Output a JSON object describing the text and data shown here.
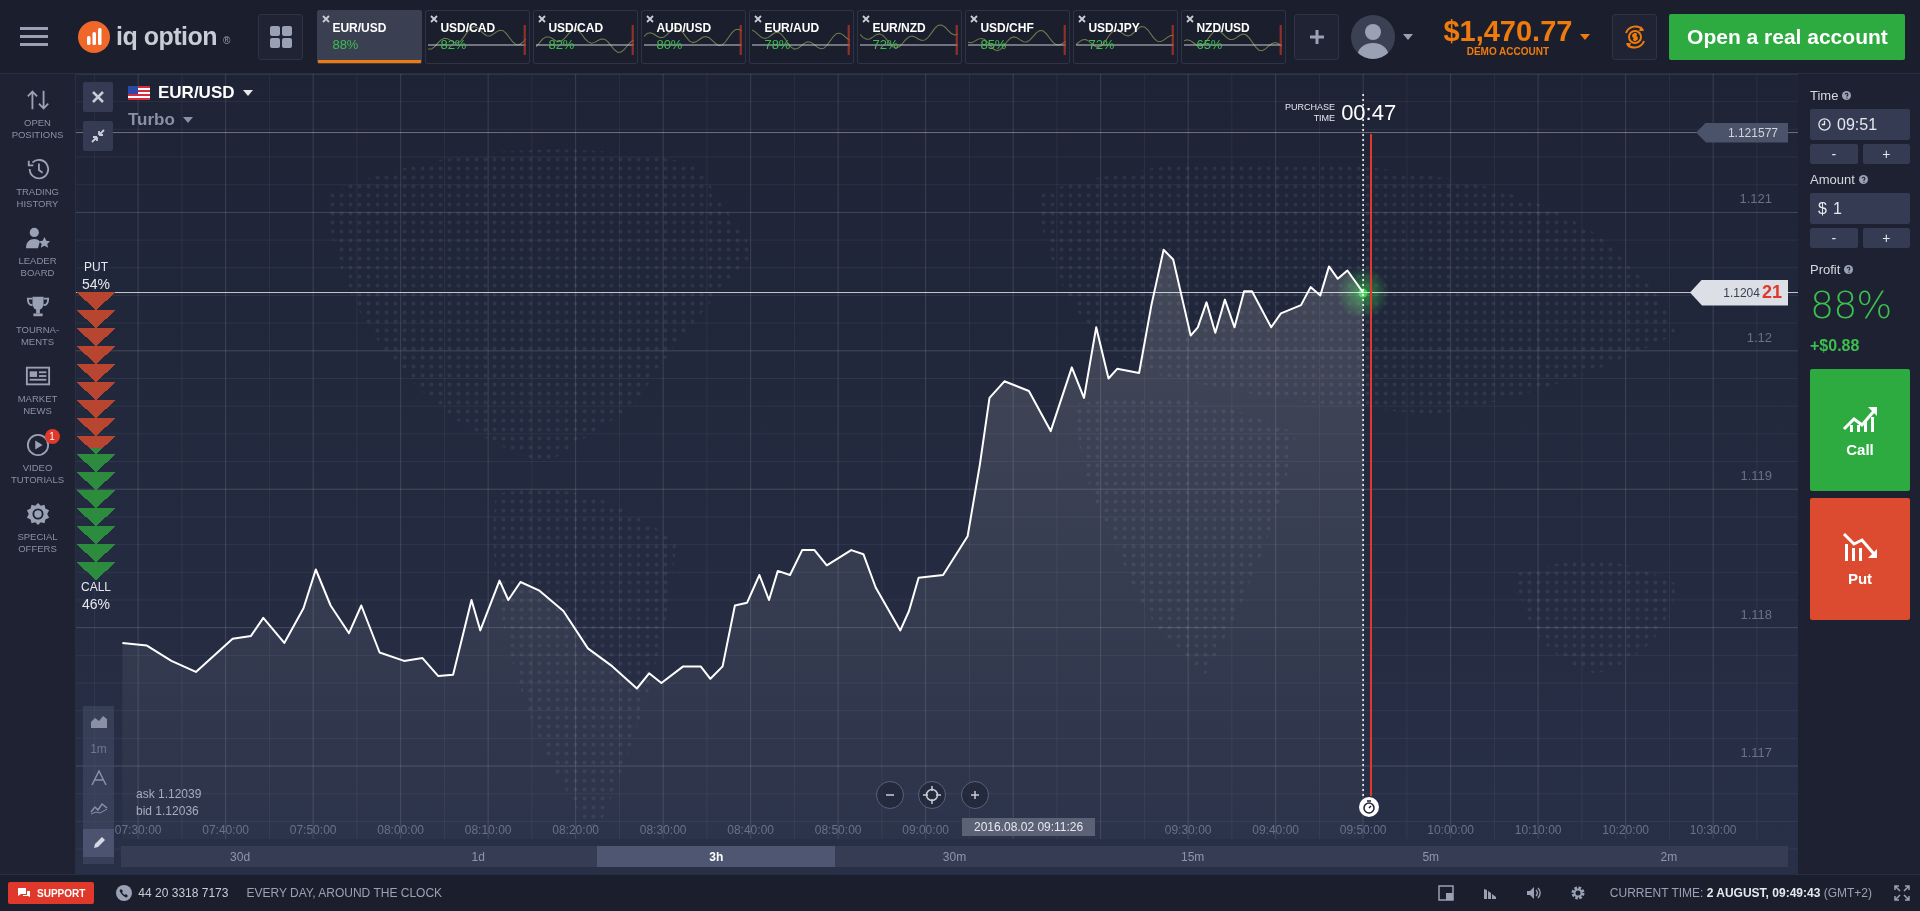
{
  "top_bar": {
    "logo_text": "iq option",
    "logo_mark": "®",
    "asset_tabs": [
      {
        "name": "EUR/USD",
        "percent": "88%",
        "selected": true
      },
      {
        "name": "USD/CAD",
        "percent": "82%",
        "selected": false
      },
      {
        "name": "USD/CAD",
        "percent": "82%",
        "selected": false
      },
      {
        "name": "AUD/USD",
        "percent": "80%",
        "selected": false
      },
      {
        "name": "EUR/AUD",
        "percent": "78%",
        "selected": false
      },
      {
        "name": "EUR/NZD",
        "percent": "72%",
        "selected": false
      },
      {
        "name": "USD/CHF",
        "percent": "85%",
        "selected": false
      },
      {
        "name": "USD/JPY",
        "percent": "72%",
        "selected": false
      },
      {
        "name": "NZD/USD",
        "percent": "65%",
        "selected": false
      }
    ],
    "balance": "$1,470.77",
    "account_type": "DEMO ACCOUNT",
    "cta": "Open a real account"
  },
  "sidebar": {
    "items": [
      {
        "kind": "positions",
        "label": "OPEN POSITIONS"
      },
      {
        "kind": "history",
        "label": "TRADING HISTORY"
      },
      {
        "kind": "leaderboard",
        "label": "LEADER BOARD"
      },
      {
        "kind": "tournaments",
        "label": "TOURNA-MENTS"
      },
      {
        "kind": "news",
        "label": "MARKET NEWS"
      },
      {
        "kind": "video",
        "label": "VIDEO TUTORIALS",
        "badge": "1"
      },
      {
        "kind": "offers",
        "label": "SPECIAL OFFERS"
      }
    ]
  },
  "chart": {
    "asset": "EUR/USD",
    "mode": "Turbo",
    "sentiment": {
      "put_label": "PUT",
      "put_percent": "54%",
      "call_label": "CALL",
      "call_percent": "46%",
      "level": 0.54
    },
    "purchase_time": {
      "label": "PURCHASE TIME",
      "value": "00:47"
    },
    "current_price": {
      "main": "1.1204",
      "last_digits": "21"
    },
    "timeframe": "1m",
    "ask": "ask 1.12039",
    "bid": "bid 1.12036",
    "cursor_time": "2016.08.02 09:11:26",
    "ranges": [
      {
        "label": "30d",
        "selected": false
      },
      {
        "label": "1d",
        "selected": false
      },
      {
        "label": "3h",
        "selected": true
      },
      {
        "label": "30m",
        "selected": false
      },
      {
        "label": "15m",
        "selected": false
      },
      {
        "label": "5m",
        "selected": false
      },
      {
        "label": "2m",
        "selected": false
      }
    ],
    "chart_data": {
      "type": "line",
      "xlim": [
        442.9,
        639.7
      ],
      "ylim": [
        1.11622,
        1.122
      ],
      "x": [
        448.2,
        451.0,
        453.8,
        456.6,
        460.8,
        462.9,
        464.3,
        466.7,
        468.9,
        470.3,
        472.0,
        474.1,
        475.5,
        477.6,
        480.4,
        482.5,
        484.3,
        486.0,
        488.1,
        489.1,
        491.3,
        492.3,
        493.7,
        495.8,
        498.6,
        501.4,
        504.2,
        507.0,
        508.4,
        509.8,
        512.3,
        514.3,
        515.4,
        516.8,
        518.2,
        519.6,
        521.0,
        522.1,
        523.1,
        524.5,
        525.9,
        527.3,
        528.7,
        531.5,
        532.9,
        534.3,
        537.1,
        538.1,
        539.2,
        542.0,
        544.8,
        546.2,
        547.3,
        549.0,
        551.8,
        554.3,
        556.7,
        558.1,
        559.5,
        560.9,
        561.9,
        564.4,
        565.8,
        567.2,
        568.3,
        570.3,
        571.1,
        572.1,
        573.1,
        574.2,
        575.3,
        576.4,
        577.3,
        579.5,
        580.6,
        582.9,
        584.0,
        585.1,
        586.1,
        587.1,
        588.2,
        590.0
      ],
      "series": [
        {
          "color": "#ffffff",
          "values": [
            1.11789,
            1.11787,
            1.11776,
            1.11768,
            1.11792,
            1.11794,
            1.11807,
            1.11789,
            1.11814,
            1.11842,
            1.11816,
            1.11796,
            1.11816,
            1.11782,
            1.11776,
            1.11778,
            1.11765,
            1.11766,
            1.1182,
            1.11798,
            1.11834,
            1.1182,
            1.11833,
            1.11827,
            1.11812,
            1.11785,
            1.11772,
            1.11756,
            1.11767,
            1.1176,
            1.11772,
            1.11772,
            1.11763,
            1.11772,
            1.11816,
            1.11818,
            1.11838,
            1.1182,
            1.11841,
            1.11838,
            1.11856,
            1.11856,
            1.11845,
            1.11856,
            1.11853,
            1.11829,
            1.11798,
            1.11812,
            1.11836,
            1.11838,
            1.11866,
            1.11918,
            1.11966,
            1.11978,
            1.11971,
            1.11942,
            1.11988,
            1.11966,
            1.12017,
            1.1198,
            1.11987,
            1.11984,
            1.12033,
            1.12073,
            1.12066,
            1.12011,
            1.12017,
            1.12035,
            1.12013,
            1.12037,
            1.12017,
            1.12043,
            1.12043,
            1.12017,
            1.12027,
            1.12033,
            1.12046,
            1.1204,
            1.12061,
            1.12052,
            1.12058,
            1.120421
          ]
        }
      ],
      "xticks": [
        {
          "value": 450,
          "label": "07:30:00"
        },
        {
          "value": 460,
          "label": "07:40:00"
        },
        {
          "value": 470,
          "label": "07:50:00"
        },
        {
          "value": 480,
          "label": "08:00:00"
        },
        {
          "value": 490,
          "label": "08:10:00"
        },
        {
          "value": 500,
          "label": "08:20:00"
        },
        {
          "value": 510,
          "label": "08:30:00"
        },
        {
          "value": 520,
          "label": "08:40:00"
        },
        {
          "value": 530,
          "label": "08:50:00"
        },
        {
          "value": 540,
          "label": "09:00:00"
        },
        {
          "value": 570,
          "label": "09:30:00"
        },
        {
          "value": 580,
          "label": "09:40:00"
        },
        {
          "value": 590,
          "label": "09:50:00"
        },
        {
          "value": 600,
          "label": "10:00:00"
        },
        {
          "value": 610,
          "label": "10:10:00"
        },
        {
          "value": 620,
          "label": "10:20:00"
        },
        {
          "value": 630,
          "label": "10:30:00"
        }
      ],
      "yticks": [
        {
          "value": 1.117,
          "label": "1.117"
        },
        {
          "value": 1.118,
          "label": "1.118"
        },
        {
          "value": 1.119,
          "label": "1.119"
        },
        {
          "value": 1.12,
          "label": "1.12"
        },
        {
          "value": 1.121,
          "label": "1.121"
        }
      ],
      "grid": true,
      "ref_lines": [
        {
          "axis": "y",
          "value": 1.121577,
          "label": "1.121577",
          "color": "#ffffff"
        },
        {
          "axis": "y",
          "value": 1.120421,
          "color": "#ffffff"
        },
        {
          "axis": "x",
          "value": 590.0,
          "color": "#ffffff"
        },
        {
          "axis": "x",
          "value": 590.9,
          "color": "#e0392b"
        }
      ]
    }
  },
  "trade_panel": {
    "time": {
      "label": "Time",
      "value": "09:51",
      "minus": "-",
      "plus": "+"
    },
    "amount": {
      "label": "Amount",
      "currency": "$",
      "value": "1",
      "minus": "-",
      "plus": "+"
    },
    "profit": {
      "label": "Profit",
      "percent": "88%",
      "amount": "+$0.88"
    },
    "call_button": "Call",
    "put_button": "Put"
  },
  "status_bar": {
    "support": "SUPPORT",
    "phone": "44 20 3318 7173",
    "hours": "EVERY DAY, AROUND THE CLOCK",
    "current_time": "CURRENT TIME: **2 AUGUST, 09:49:43** (GMT+2)"
  }
}
